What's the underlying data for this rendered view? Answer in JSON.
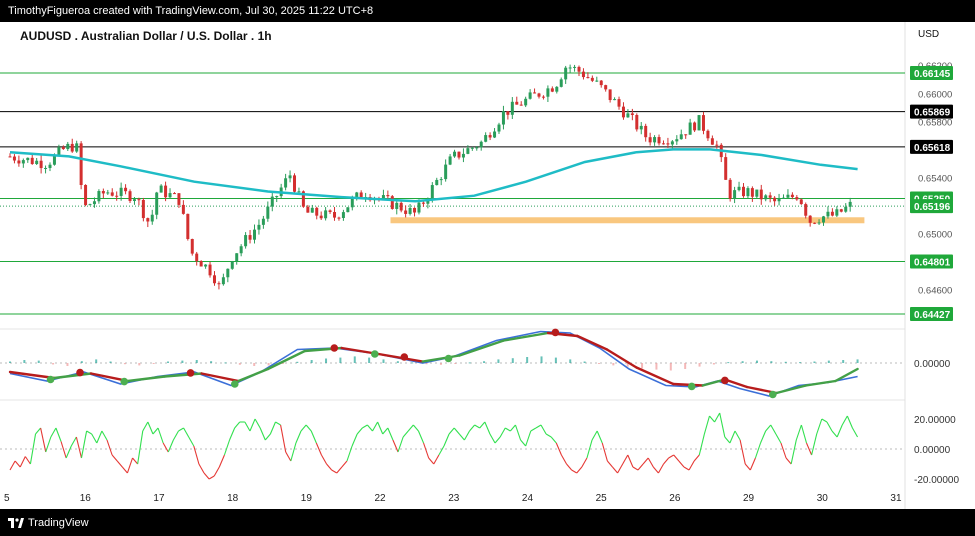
{
  "header": {
    "attribution": "TimothyFigueroa created with TradingView.com, Jul 30, 2025 11:22 UTC+8"
  },
  "footer": {
    "brand": "TradingView",
    "logo_icon": "tradingview-logo-icon"
  },
  "colors": {
    "background": "#ffffff",
    "bull": "#2a9d5a",
    "bear": "#d32f2f",
    "ma": "#1fbcc6",
    "support_band": "#f9c77f",
    "green_level": "#1fa83a",
    "black_level": "#000000",
    "macd_line": "#3b6fd8",
    "signal_bull": "#43a047",
    "signal_bear": "#b71c1c",
    "osc_up": "#33e050",
    "osc_down": "#e53935"
  },
  "chart_data": [
    {
      "type": "candlestick",
      "title": "AUDUSD . Australian Dollar / U.S. Dollar . 1h",
      "currency": "USD",
      "x_ticks": [
        "5",
        "16",
        "17",
        "18",
        "19",
        "22",
        "23",
        "24",
        "25",
        "26",
        "29",
        "30",
        "31"
      ],
      "y_ticks": [
        "0.66200",
        "0.66000",
        "0.65800",
        "0.65400",
        "0.65000",
        "0.64600"
      ],
      "ylim": [
        0.6437,
        0.6628
      ],
      "price_labels": [
        {
          "value": "0.66145",
          "style": "green"
        },
        {
          "value": "0.65869",
          "style": "black"
        },
        {
          "value": "0.65618",
          "style": "black"
        },
        {
          "value": "0.65250",
          "style": "green"
        },
        {
          "value": "0.65196",
          "style": "current"
        },
        {
          "value": "0.64801",
          "style": "green"
        },
        {
          "value": "0.64427",
          "style": "green"
        }
      ],
      "horizontal_levels": [
        0.66145,
        0.65869,
        0.65618,
        0.6525,
        0.64801,
        0.64427
      ],
      "support_zone": {
        "from_day": "22",
        "to_day": "31",
        "price": 0.65095
      },
      "close_path": [
        {
          "x": 0.0,
          "y": 0.6555
        },
        {
          "x": 0.5,
          "y": 0.655
        },
        {
          "x": 0.75,
          "y": 0.6561
        },
        {
          "x": 0.9,
          "y": 0.6563
        },
        {
          "x": 1.0,
          "y": 0.6518
        },
        {
          "x": 1.3,
          "y": 0.653
        },
        {
          "x": 1.7,
          "y": 0.6527
        },
        {
          "x": 1.9,
          "y": 0.6506
        },
        {
          "x": 2.0,
          "y": 0.6532
        },
        {
          "x": 2.3,
          "y": 0.6524
        },
        {
          "x": 2.45,
          "y": 0.6487
        },
        {
          "x": 2.75,
          "y": 0.6472
        },
        {
          "x": 2.85,
          "y": 0.646
        },
        {
          "x": 3.0,
          "y": 0.6483
        },
        {
          "x": 3.4,
          "y": 0.6508
        },
        {
          "x": 3.65,
          "y": 0.653
        },
        {
          "x": 3.8,
          "y": 0.6542
        },
        {
          "x": 4.0,
          "y": 0.6515
        },
        {
          "x": 4.4,
          "y": 0.6512
        },
        {
          "x": 4.8,
          "y": 0.653
        },
        {
          "x": 5.2,
          "y": 0.6521
        },
        {
          "x": 5.5,
          "y": 0.6514
        },
        {
          "x": 5.7,
          "y": 0.653
        },
        {
          "x": 6.0,
          "y": 0.6554
        },
        {
          "x": 6.4,
          "y": 0.6565
        },
        {
          "x": 6.7,
          "y": 0.6586
        },
        {
          "x": 7.0,
          "y": 0.6595
        },
        {
          "x": 7.4,
          "y": 0.6606
        },
        {
          "x": 7.55,
          "y": 0.662
        },
        {
          "x": 7.75,
          "y": 0.6615
        },
        {
          "x": 8.0,
          "y": 0.6605
        },
        {
          "x": 8.4,
          "y": 0.6583
        },
        {
          "x": 8.65,
          "y": 0.6568
        },
        {
          "x": 9.0,
          "y": 0.6568
        },
        {
          "x": 9.35,
          "y": 0.658
        },
        {
          "x": 9.6,
          "y": 0.6562
        },
        {
          "x": 9.75,
          "y": 0.6528
        },
        {
          "x": 10.0,
          "y": 0.653
        },
        {
          "x": 10.4,
          "y": 0.6522
        },
        {
          "x": 10.7,
          "y": 0.6528
        },
        {
          "x": 10.85,
          "y": 0.6509
        },
        {
          "x": 11.0,
          "y": 0.6512
        },
        {
          "x": 11.2,
          "y": 0.6513
        },
        {
          "x": 11.4,
          "y": 0.652
        }
      ],
      "moving_average": [
        {
          "x": 0.0,
          "y": 0.6558
        },
        {
          "x": 0.8,
          "y": 0.6555
        },
        {
          "x": 1.5,
          "y": 0.6548
        },
        {
          "x": 2.5,
          "y": 0.6537
        },
        {
          "x": 3.5,
          "y": 0.653
        },
        {
          "x": 4.5,
          "y": 0.6526
        },
        {
          "x": 5.5,
          "y": 0.6523
        },
        {
          "x": 6.3,
          "y": 0.6527
        },
        {
          "x": 7.0,
          "y": 0.6537
        },
        {
          "x": 7.8,
          "y": 0.6551
        },
        {
          "x": 8.5,
          "y": 0.6558
        },
        {
          "x": 9.0,
          "y": 0.656
        },
        {
          "x": 9.5,
          "y": 0.656
        },
        {
          "x": 10.2,
          "y": 0.6556
        },
        {
          "x": 11.0,
          "y": 0.6549
        },
        {
          "x": 11.5,
          "y": 0.6546
        }
      ]
    },
    {
      "type": "macd",
      "y_ticks": [
        "0.00000"
      ],
      "macd_line": [
        {
          "x": 0.0,
          "y": -0.35
        },
        {
          "x": 0.5,
          "y": -0.6
        },
        {
          "x": 1.0,
          "y": -0.3
        },
        {
          "x": 1.5,
          "y": -0.7
        },
        {
          "x": 2.0,
          "y": -0.45
        },
        {
          "x": 2.5,
          "y": -0.3
        },
        {
          "x": 3.0,
          "y": -0.75
        },
        {
          "x": 3.4,
          "y": -0.3
        },
        {
          "x": 3.9,
          "y": 0.45
        },
        {
          "x": 4.4,
          "y": 0.5
        },
        {
          "x": 5.0,
          "y": 0.3
        },
        {
          "x": 5.6,
          "y": 0.0
        },
        {
          "x": 6.0,
          "y": 0.2
        },
        {
          "x": 6.6,
          "y": 0.75
        },
        {
          "x": 7.2,
          "y": 1.05
        },
        {
          "x": 7.6,
          "y": 1.0
        },
        {
          "x": 8.0,
          "y": 0.5
        },
        {
          "x": 8.4,
          "y": -0.2
        },
        {
          "x": 8.9,
          "y": -0.75
        },
        {
          "x": 9.3,
          "y": -0.8
        },
        {
          "x": 9.6,
          "y": -0.6
        },
        {
          "x": 9.9,
          "y": -0.85
        },
        {
          "x": 10.3,
          "y": -1.1
        },
        {
          "x": 10.7,
          "y": -0.75
        },
        {
          "x": 11.1,
          "y": -0.65
        },
        {
          "x": 11.5,
          "y": -0.45
        }
      ],
      "signal_line": [
        {
          "x": 0.0,
          "y": -0.3
        },
        {
          "x": 0.6,
          "y": -0.5
        },
        {
          "x": 1.1,
          "y": -0.35
        },
        {
          "x": 1.6,
          "y": -0.6
        },
        {
          "x": 2.1,
          "y": -0.45
        },
        {
          "x": 2.6,
          "y": -0.35
        },
        {
          "x": 3.1,
          "y": -0.6
        },
        {
          "x": 3.5,
          "y": -0.2
        },
        {
          "x": 4.0,
          "y": 0.4
        },
        {
          "x": 4.5,
          "y": 0.5
        },
        {
          "x": 5.0,
          "y": 0.3
        },
        {
          "x": 5.6,
          "y": 0.05
        },
        {
          "x": 6.1,
          "y": 0.25
        },
        {
          "x": 6.7,
          "y": 0.75
        },
        {
          "x": 7.3,
          "y": 1.0
        },
        {
          "x": 7.7,
          "y": 0.9
        },
        {
          "x": 8.1,
          "y": 0.45
        },
        {
          "x": 8.5,
          "y": -0.15
        },
        {
          "x": 9.0,
          "y": -0.7
        },
        {
          "x": 9.4,
          "y": -0.75
        },
        {
          "x": 9.7,
          "y": -0.55
        },
        {
          "x": 10.0,
          "y": -0.8
        },
        {
          "x": 10.4,
          "y": -1.0
        },
        {
          "x": 10.8,
          "y": -0.75
        },
        {
          "x": 11.2,
          "y": -0.6
        },
        {
          "x": 11.5,
          "y": -0.2
        }
      ],
      "cross_points": [
        {
          "x": 0.55,
          "y": -0.55,
          "kind": "bull"
        },
        {
          "x": 0.95,
          "y": -0.32,
          "kind": "bear"
        },
        {
          "x": 1.55,
          "y": -0.62,
          "kind": "bull"
        },
        {
          "x": 2.45,
          "y": -0.33,
          "kind": "bear"
        },
        {
          "x": 3.05,
          "y": -0.7,
          "kind": "bull"
        },
        {
          "x": 4.4,
          "y": 0.5,
          "kind": "bear"
        },
        {
          "x": 4.95,
          "y": 0.3,
          "kind": "bull"
        },
        {
          "x": 5.35,
          "y": 0.2,
          "kind": "bear"
        },
        {
          "x": 5.95,
          "y": 0.15,
          "kind": "bull"
        },
        {
          "x": 7.4,
          "y": 1.02,
          "kind": "bear"
        },
        {
          "x": 9.25,
          "y": -0.78,
          "kind": "bull"
        },
        {
          "x": 9.7,
          "y": -0.58,
          "kind": "bear"
        },
        {
          "x": 10.35,
          "y": -1.05,
          "kind": "bull"
        }
      ],
      "histogram": [
        0.05,
        0.1,
        0.08,
        -0.05,
        -0.1,
        0.06,
        0.12,
        0.05,
        -0.04,
        -0.08,
        -0.02,
        0.05,
        0.08,
        0.1,
        0.06,
        0.02,
        -0.06,
        -0.1,
        -0.08,
        -0.03,
        0.04,
        0.1,
        0.15,
        0.18,
        0.22,
        0.18,
        0.12,
        0.06,
        0.02,
        -0.04,
        -0.06,
        -0.03,
        0.02,
        0.06,
        0.12,
        0.16,
        0.2,
        0.22,
        0.18,
        0.12,
        0.05,
        -0.02,
        -0.08,
        -0.12,
        -0.18,
        -0.22,
        -0.25,
        -0.2,
        -0.12,
        -0.05,
        0.03,
        0.06,
        0.08,
        0.06,
        0.04,
        0.03,
        0.05,
        0.08,
        0.1,
        0.12
      ]
    },
    {
      "type": "oscillator",
      "y_ticks": [
        "20.00000",
        "0.00000",
        "-20.00000"
      ],
      "ylim": [
        -25,
        25
      ],
      "values": [
        -14,
        -8,
        -12,
        -5,
        -10,
        10,
        14,
        -2,
        8,
        14,
        5,
        -6,
        2,
        8,
        -6,
        12,
        10,
        4,
        12,
        6,
        -4,
        -8,
        -12,
        -16,
        -6,
        -10,
        12,
        18,
        10,
        14,
        4,
        -2,
        6,
        12,
        14,
        8,
        2,
        -10,
        -16,
        -20,
        -18,
        -12,
        -4,
        6,
        14,
        18,
        18,
        12,
        20,
        14,
        6,
        10,
        18,
        16,
        -2,
        -8,
        4,
        12,
        16,
        12,
        4,
        -4,
        -10,
        -14,
        -16,
        -12,
        -8,
        2,
        10,
        14,
        16,
        12,
        18,
        10,
        14,
        6,
        -2,
        8,
        12,
        16,
        12,
        4,
        -6,
        -10,
        -4,
        2,
        10,
        14,
        10,
        6,
        12,
        16,
        14,
        18,
        10,
        4,
        8,
        14,
        12,
        16,
        6,
        2,
        12,
        14,
        16,
        10,
        8,
        4,
        -4,
        -10,
        -14,
        -16,
        -12,
        -6,
        6,
        12,
        4,
        -8,
        -12,
        -16,
        -10,
        -4,
        -12,
        -14,
        -10,
        -6,
        -12,
        -16,
        -10,
        -6,
        -4,
        -8,
        -12,
        -14,
        -8,
        -4,
        10,
        22,
        18,
        24,
        8,
        4,
        12,
        6,
        -10,
        -14,
        -6,
        4,
        12,
        16,
        10,
        4,
        -6,
        -10,
        6,
        16,
        4,
        -4,
        10,
        20,
        18,
        12,
        8,
        16,
        22,
        14,
        8
      ]
    }
  ]
}
